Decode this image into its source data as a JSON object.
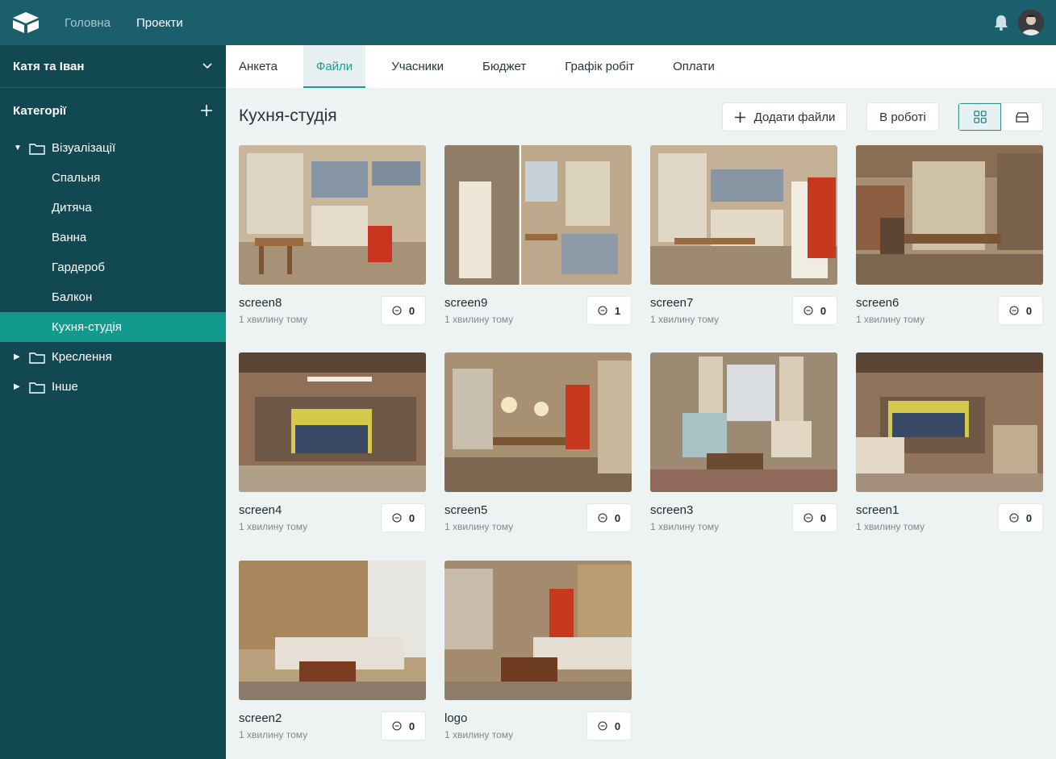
{
  "topbar": {
    "nav": [
      {
        "label": "Головна",
        "active": false
      },
      {
        "label": "Проекти",
        "active": true
      }
    ]
  },
  "sidebar": {
    "project": "Катя та Іван",
    "categories_label": "Категорії",
    "tree": [
      {
        "label": "Візуалізації",
        "expanded": true,
        "children": [
          "Спальня",
          "Дитяча",
          "Ванна",
          "Гардероб",
          "Балкон",
          "Кухня-студія"
        ]
      },
      {
        "label": "Креслення",
        "expanded": false
      },
      {
        "label": "Інше",
        "expanded": false
      }
    ],
    "active_item": "Кухня-студія"
  },
  "tabs": [
    "Анкета",
    "Файли",
    "Учасники",
    "Бюджет",
    "Графік робіт",
    "Оплати"
  ],
  "active_tab": "Файли",
  "main": {
    "title": "Кухня-студія",
    "add_files": "Додати файли",
    "status": "В роботі"
  },
  "files": [
    {
      "name": "screen8",
      "time": "1 хвилину тому",
      "comments": "0"
    },
    {
      "name": "screen9",
      "time": "1 хвилину тому",
      "comments": "1"
    },
    {
      "name": "screen7",
      "time": "1 хвилину тому",
      "comments": "0"
    },
    {
      "name": "screen6",
      "time": "1 хвилину тому",
      "comments": "0"
    },
    {
      "name": "screen4",
      "time": "1 хвилину тому",
      "comments": "0"
    },
    {
      "name": "screen5",
      "time": "1 хвилину тому",
      "comments": "0"
    },
    {
      "name": "screen3",
      "time": "1 хвилину тому",
      "comments": "0"
    },
    {
      "name": "screen1",
      "time": "1 хвилину тому",
      "comments": "0"
    },
    {
      "name": "screen2",
      "time": "1 хвилину тому",
      "comments": "0"
    },
    {
      "name": "logo",
      "time": "1 хвилину тому",
      "comments": "0"
    }
  ],
  "colors": {
    "topbar": "#1b5f6c",
    "sidebar": "#124851",
    "active_item": "#129a8e",
    "accent": "#1a9e91",
    "background": "#edf2f2"
  },
  "icons": [
    "logo-cube-icon",
    "bell-icon",
    "avatar",
    "chevron-down-icon",
    "plus-icon",
    "caret-icon",
    "folder-icon",
    "grid-view-icon",
    "list-view-icon",
    "comment-icon"
  ]
}
